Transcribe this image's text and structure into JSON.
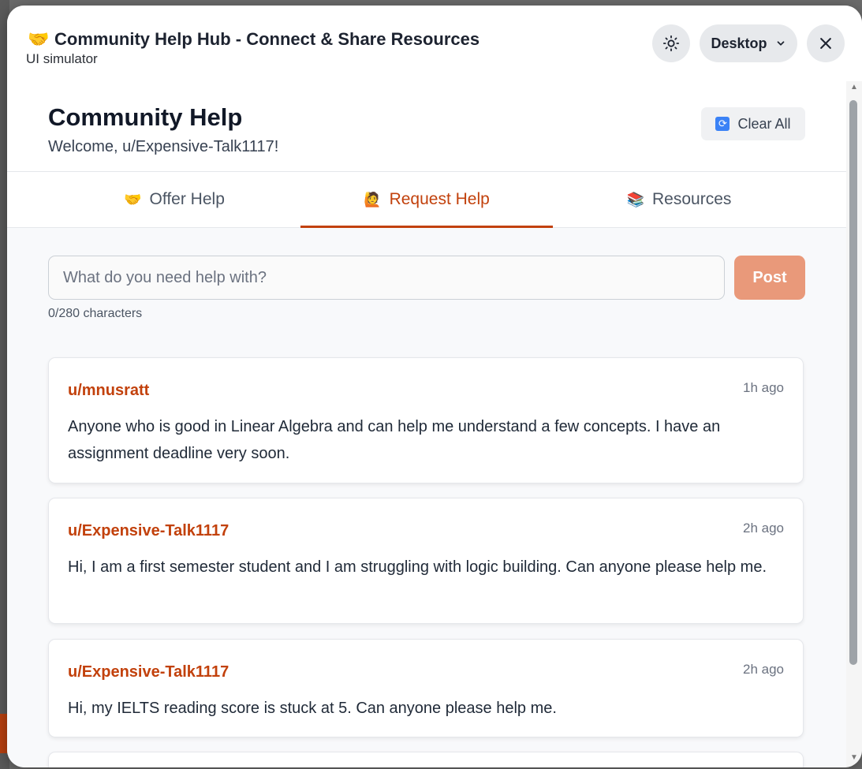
{
  "window": {
    "title": "Community Help Hub - Connect & Share Resources",
    "title_icon": "🤝",
    "subtitle": "UI simulator",
    "device_label": "Desktop"
  },
  "header": {
    "title": "Community Help",
    "welcome": "Welcome, u/Expensive-Talk1117!",
    "clear_label": "Clear All",
    "clear_icon": "🔄"
  },
  "tabs": [
    {
      "label": "Offer Help",
      "icon": "🤝",
      "active": false
    },
    {
      "label": "Request Help",
      "icon": "🙋",
      "active": true
    },
    {
      "label": "Resources",
      "icon": "📚",
      "active": false
    }
  ],
  "compose": {
    "placeholder": "What do you need help with?",
    "value": "",
    "post_label": "Post",
    "char_count": "0/280 characters"
  },
  "posts": [
    {
      "user": "u/mnusratt",
      "time": "1h ago",
      "text": "Anyone who is good in Linear Algebra and can help me understand a few concepts. I have an assignment deadline very soon."
    },
    {
      "user": "u/Expensive-Talk1117",
      "time": "2h ago",
      "text": "Hi, I am a first semester student and I am struggling with logic building. Can anyone please help me."
    },
    {
      "user": "u/Expensive-Talk1117",
      "time": "2h ago",
      "text": "Hi, my IELTS reading score is stuck at 5. Can anyone please help me."
    }
  ],
  "colors": {
    "accent": "#c2410c",
    "post_button": "#e9997a"
  }
}
